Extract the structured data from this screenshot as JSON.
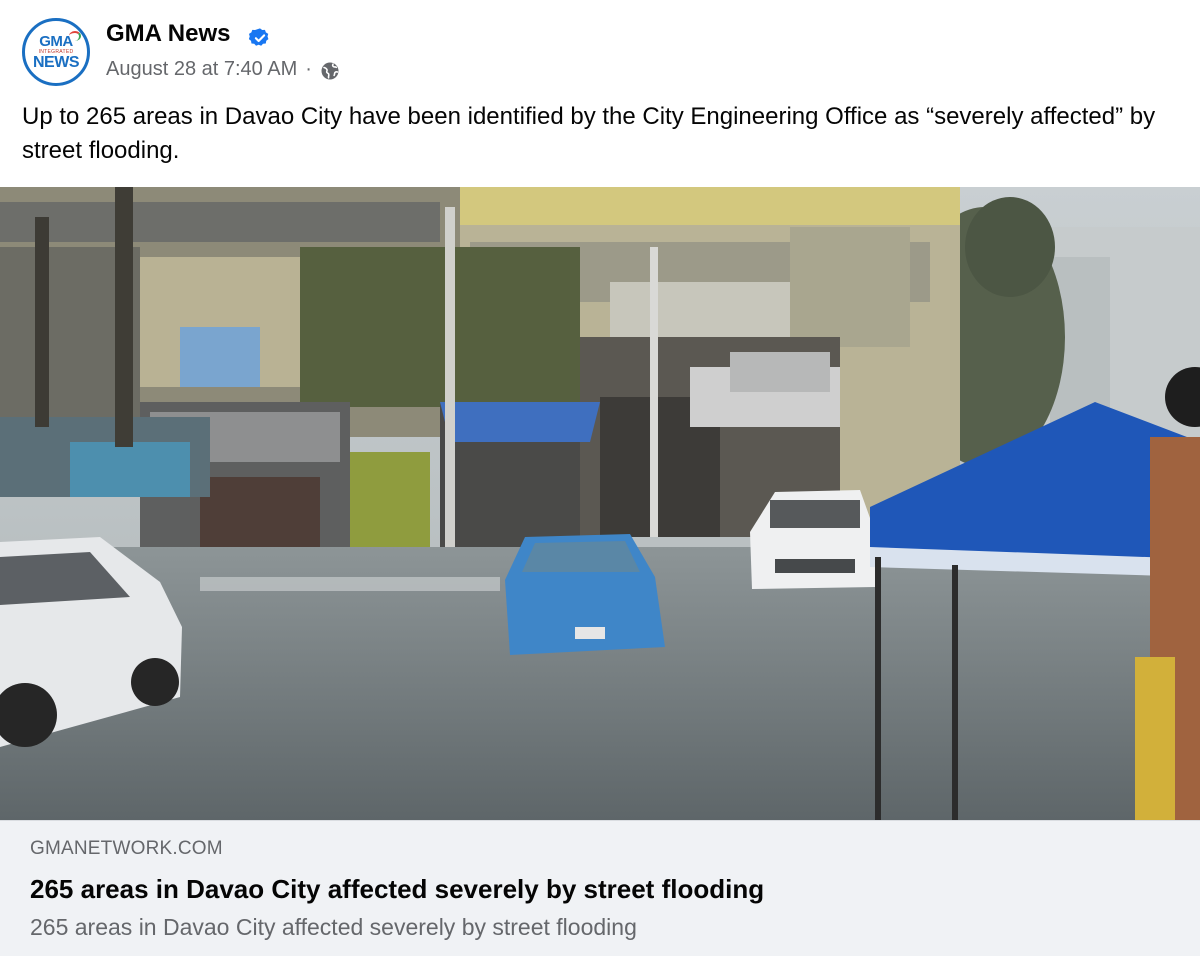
{
  "post": {
    "page_name": "GMA News",
    "timestamp": "August 28 at 7:40 AM",
    "separator": "·",
    "audience_icon": "globe-icon",
    "verified_icon": "verified-badge-icon",
    "caption": "Up to 265 areas in Davao City have been identified by the City Engineering Office as “severely affected” by street flooding."
  },
  "avatar": {
    "line1": "GMA",
    "line2": "INTEGRATED",
    "line3": "NEWS"
  },
  "link_preview": {
    "domain": "GMANETWORK.COM",
    "title": "265 areas in Davao City affected severely by street flooding",
    "description": "265 areas in Davao City affected severely by street flooding"
  },
  "colors": {
    "brand_blue": "#1a6fc2",
    "verified_blue": "#1877f2",
    "secondary_text": "#65676b",
    "card_background": "#f0f2f5"
  }
}
